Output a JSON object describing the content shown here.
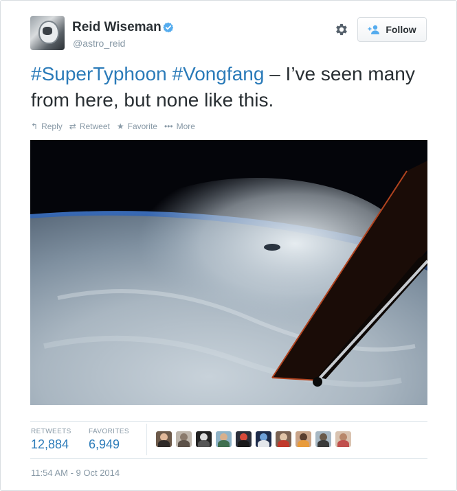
{
  "user": {
    "name": "Reid Wiseman",
    "handle": "@astro_reid",
    "verified_icon": "verified-badge-icon",
    "avatar_icon": "astronaut-avatar"
  },
  "header": {
    "settings_icon": "gear-icon",
    "follow_label": "Follow",
    "follow_icon": "add-user-icon"
  },
  "tweet": {
    "hashtag1": "#SuperTyphoon",
    "hashtag2": "#Vongfang",
    "text_rest": " – I’ve seen many from here, but none like this."
  },
  "actions": {
    "reply": "Reply",
    "retweet": "Retweet",
    "favorite": "Favorite",
    "more": "More"
  },
  "stats": {
    "retweets_label": "RETWEETS",
    "retweets_value": "12,884",
    "favorites_label": "FAVORITES",
    "favorites_value": "6,949"
  },
  "favoriters": [
    {
      "name": "favoriter-avatar-1"
    },
    {
      "name": "favoriter-avatar-2"
    },
    {
      "name": "favoriter-avatar-3"
    },
    {
      "name": "favoriter-avatar-4"
    },
    {
      "name": "favoriter-avatar-5"
    },
    {
      "name": "favoriter-avatar-6"
    },
    {
      "name": "favoriter-avatar-7"
    },
    {
      "name": "favoriter-avatar-8"
    },
    {
      "name": "favoriter-avatar-9"
    },
    {
      "name": "favoriter-avatar-10"
    }
  ],
  "timestamp": "11:54 AM - 9 Oct 2014",
  "colors": {
    "link": "#2b7bb9",
    "muted": "#8899a6",
    "text": "#292f33"
  }
}
